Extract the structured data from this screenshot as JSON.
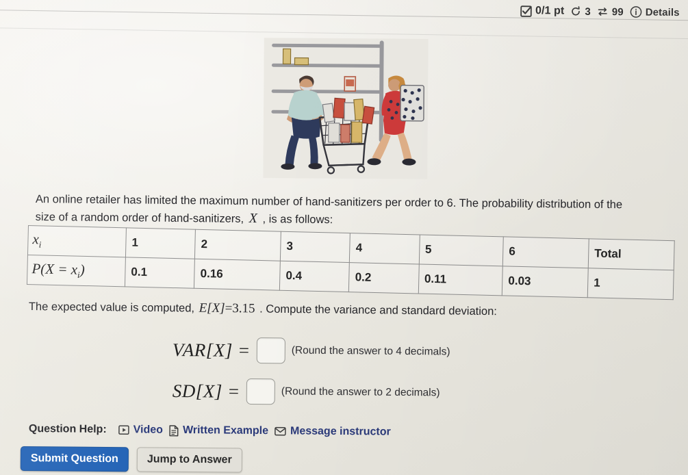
{
  "header": {
    "checkbox_icon": "checkbox-checked-icon",
    "points": "0/1 pt",
    "attempts_icon": "retry-circular-arrow-icon",
    "attempts": "3",
    "shuffle_icon": "swap-arrows-icon",
    "shuffle_count": "99",
    "info_icon": "info-circle-icon",
    "details_label": "Details"
  },
  "illustration": {
    "name": "shoppers-with-cart-illustration",
    "alt": "Two shoppers in a store aisle with a full shopping cart and shelves"
  },
  "question": {
    "text_part_1": "An online retailer has limited the maximum number of hand-sanitizers per order to 6. The probability distribution of the size of a random order of hand-sanitizers,",
    "variable": "X",
    "text_part_2": ", is as follows:"
  },
  "table": {
    "row_label_x": "x",
    "row_label_x_sub": "i",
    "row_label_p_prefix": "P(X = x",
    "row_label_p_sub": "i",
    "row_label_p_suffix": ")",
    "x_values": [
      "1",
      "2",
      "3",
      "4",
      "5",
      "6"
    ],
    "total_header": "Total",
    "probabilities": [
      "0.1",
      "0.16",
      "0.4",
      "0.2",
      "0.11",
      "0.03"
    ],
    "total_value": "1"
  },
  "expected_value": {
    "text_prefix": "The expected value is computed,",
    "formula_lhs": "E[X]",
    "formula_eq": "=",
    "formula_rhs": "3.15",
    "text_suffix": ". Compute the variance and standard deviation:"
  },
  "answers": {
    "variance": {
      "label": "VAR[X] =",
      "value": "",
      "placeholder": "",
      "hint": "(Round the answer to 4 decimals)"
    },
    "standard_deviation": {
      "label": "SD[X] =",
      "value": "",
      "placeholder": "",
      "hint": "(Round the answer to 2 decimals)"
    }
  },
  "question_help": {
    "label": "Question Help:",
    "links": [
      {
        "icon": "video-play-icon",
        "label": "Video"
      },
      {
        "icon": "document-text-icon",
        "label": "Written Example"
      },
      {
        "icon": "envelope-icon",
        "label": "Message instructor"
      }
    ]
  },
  "buttons": {
    "submit": "Submit Question",
    "jump": "Jump to Answer"
  },
  "colors": {
    "page_background": "#efede7",
    "primary_button": "#2061b5",
    "link": "#2b3a7a",
    "table_border": "#8d8d8d",
    "text": "#26262a"
  }
}
